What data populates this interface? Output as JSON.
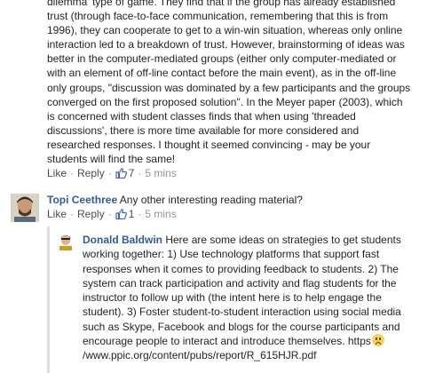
{
  "comment1": {
    "text": "dilemma' type of game. They find that if the group has already established\ntrust (through face-to-face communication, remembering that this is from\n1996), they can cooperate to get to a win-win situation, whereas only online\ninteraction led to a breakdown of trust. However, brainstorming of ideas was\nbetter in the computer-mediated groups (either only computer-mediated or\nwith an element of off-line contact before the main event), as in the off-line\nonly groups, \"discussion was dominated by a few participants and the groups\nconverged on the first proposed solution\". In the Meyer paper (2003), which\nis concerned with student classes finds that when using 'threaded\ndiscussions', there is more time available for more considered and\nresearched responses. I thought it seemed convincing - may be your\nstudents will find the same!",
    "like": "Like",
    "reply": "Reply",
    "likes": "7",
    "time": "5 mins"
  },
  "comment2": {
    "author": "Topi Ceethree",
    "text": "Any other interesting reading material?",
    "like": "Like",
    "reply": "Reply",
    "likes": "1",
    "time": "5 mins"
  },
  "comment3": {
    "author": "Donald Baldwin",
    "text": "Here are some ideas on strategies to get students\nworking together: 1) Use technology platforms that support fast\nresponses when it comes to providing feedback to students. 2) The\nsystem can track participation and activity and flag students for the\ninstructor to follow up with (the intent here is to help engage the\nstudent). 3) Foster student-to-student interaction using social media\nsuch as Skype, Facebook and blogs for the course participants and\nencourage people to interact and introduce themselves. https",
    "link_tail": "/www.ppic.org/content/pubs/report/R_615HJR.pdf"
  },
  "icons": {
    "like": "thumbs-up-icon",
    "emoji": "frowning-face-emoji"
  },
  "colors": {
    "link": "#365899",
    "action": "#4b4f56",
    "meta": "#90949c",
    "thumb": "#4267b2"
  }
}
